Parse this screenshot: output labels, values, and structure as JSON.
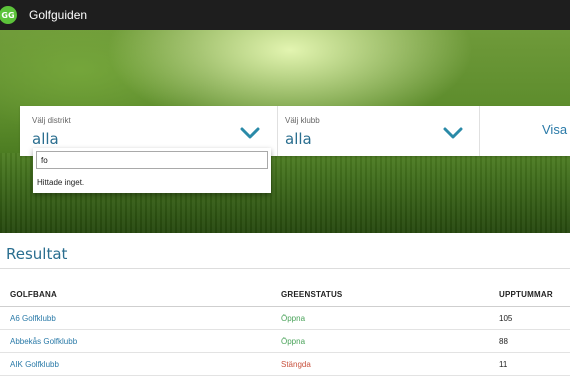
{
  "header": {
    "logo_text": "GG",
    "brand": "Golfguiden",
    "brand_color": "#5cc33a"
  },
  "filters": {
    "district": {
      "label": "Välj distrikt",
      "value": "alla"
    },
    "club": {
      "label": "Välj klubb",
      "value": "alla"
    },
    "submit_label": "Visa"
  },
  "dropdown": {
    "search_value": "fo",
    "empty_message": "Hittade inget."
  },
  "results": {
    "title": "Resultat",
    "columns": [
      "GOLFBANA",
      "GREENSTATUS",
      "UPPTUMMAR"
    ],
    "rows": [
      {
        "course": "A6 Golfklubb",
        "status": "Öppna",
        "status_type": "open",
        "count": "105"
      },
      {
        "course": "Abbekås Golfklubb",
        "status": "Öppna",
        "status_type": "open",
        "count": "88"
      },
      {
        "course": "AIK Golfklubb",
        "status": "Stängda",
        "status_type": "closed",
        "count": "11"
      }
    ]
  },
  "colors": {
    "accent": "#2a6e8f",
    "open": "#4aa35a",
    "closed": "#c9533f",
    "topbar": "#1e1e1e"
  }
}
